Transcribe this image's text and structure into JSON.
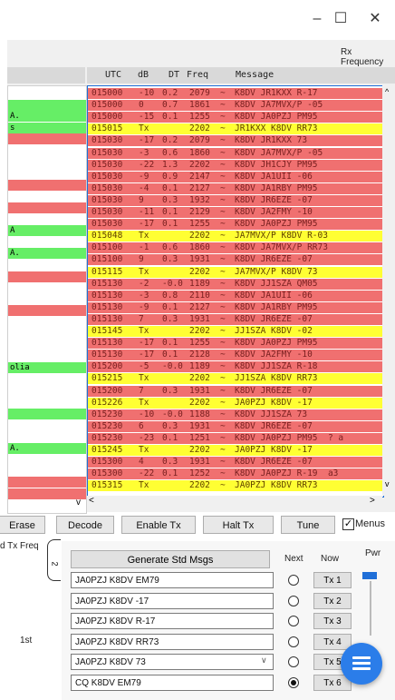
{
  "window": {
    "minimize": "–",
    "maximize": "☐",
    "close": "✕"
  },
  "rx_frequency_label": "Rx Frequency",
  "columns": {
    "utc": "UTC",
    "db": "dB",
    "dt": "DT",
    "freq": "Freq",
    "message": "Message"
  },
  "left_rows": [
    {
      "text": "",
      "color": "#ffffff"
    },
    {
      "text": "",
      "color": "#66ee66"
    },
    {
      "text": "A.",
      "color": "#66ee66"
    },
    {
      "text": "s",
      "color": "#66ee66"
    },
    {
      "text": "",
      "color": "#f07070"
    },
    {
      "text": "",
      "color": "#ffffff"
    },
    {
      "text": "",
      "color": "#ffffff"
    },
    {
      "text": "",
      "color": "#ffffff"
    },
    {
      "text": "",
      "color": "#f07070"
    },
    {
      "text": "",
      "color": "#ffffff"
    },
    {
      "text": "",
      "color": "#f07070"
    },
    {
      "text": "",
      "color": "#ffffff"
    },
    {
      "text": "A",
      "color": "#66ee66"
    },
    {
      "text": "",
      "color": "#ffffff"
    },
    {
      "text": "A.",
      "color": "#66ee66"
    },
    {
      "text": "",
      "color": "#ffffff"
    },
    {
      "text": "",
      "color": "#f07070"
    },
    {
      "text": "",
      "color": "#ffffff"
    },
    {
      "text": "",
      "color": "#ffffff"
    },
    {
      "text": "",
      "color": "#f07070"
    },
    {
      "text": "",
      "color": "#ffffff"
    },
    {
      "text": "",
      "color": "#ffffff"
    },
    {
      "text": "",
      "color": "#ffffff"
    },
    {
      "text": "",
      "color": "#ffffff"
    },
    {
      "text": "olia",
      "color": "#66ee66"
    },
    {
      "text": "",
      "color": "#ffffff"
    },
    {
      "text": "",
      "color": "#ffffff"
    },
    {
      "text": "",
      "color": "#ffffff"
    },
    {
      "text": "",
      "color": "#66ee66"
    },
    {
      "text": "",
      "color": "#ffffff"
    },
    {
      "text": "",
      "color": "#ffffff"
    },
    {
      "text": "A.",
      "color": "#66ee66"
    },
    {
      "text": "",
      "color": "#ffffff"
    },
    {
      "text": "",
      "color": "#ffffff"
    },
    {
      "text": "",
      "color": "#f07070"
    },
    {
      "text": "",
      "color": "#f07070"
    },
    {
      "text": "",
      "color": "#ffffff"
    }
  ],
  "rx_rows": [
    {
      "utc": "015000",
      "db": "-10",
      "dt": "0.2",
      "freq": "2079",
      "sep": "~",
      "msg": "K8DV JR1KXX R-17",
      "kind": "red"
    },
    {
      "utc": "015000",
      "db": "0",
      "dt": "0.7",
      "freq": "1861",
      "sep": "~",
      "msg": "K8DV JA7MVX/P -05",
      "kind": "red"
    },
    {
      "utc": "015000",
      "db": "-15",
      "dt": "0.1",
      "freq": "1255",
      "sep": "~",
      "msg": "K8DV JA0PZJ PM95",
      "kind": "red"
    },
    {
      "utc": "015015",
      "db": "Tx",
      "dt": "",
      "freq": "2202",
      "sep": "~",
      "msg": "JR1KXX K8DV RR73",
      "kind": "yellow"
    },
    {
      "utc": "015030",
      "db": "-17",
      "dt": "0.2",
      "freq": "2079",
      "sep": "~",
      "msg": "K8DV JR1KXX 73",
      "kind": "red"
    },
    {
      "utc": "015030",
      "db": "-3",
      "dt": "0.6",
      "freq": "1860",
      "sep": "~",
      "msg": "K8DV JA7MVX/P -05",
      "kind": "red"
    },
    {
      "utc": "015030",
      "db": "-22",
      "dt": "1.3",
      "freq": "2202",
      "sep": "~",
      "msg": "K8DV JH1CJY PM95",
      "kind": "red"
    },
    {
      "utc": "015030",
      "db": "-9",
      "dt": "0.9",
      "freq": "2147",
      "sep": "~",
      "msg": "K8DV JA1UII -06",
      "kind": "red"
    },
    {
      "utc": "015030",
      "db": "-4",
      "dt": "0.1",
      "freq": "2127",
      "sep": "~",
      "msg": "K8DV JA1RBY PM95",
      "kind": "red"
    },
    {
      "utc": "015030",
      "db": "9",
      "dt": "0.3",
      "freq": "1932",
      "sep": "~",
      "msg": "K8DV JR6EZE -07",
      "kind": "red"
    },
    {
      "utc": "015030",
      "db": "-11",
      "dt": "0.1",
      "freq": "2129",
      "sep": "~",
      "msg": "K8DV JA2FMY -10",
      "kind": "red"
    },
    {
      "utc": "015030",
      "db": "-17",
      "dt": "0.1",
      "freq": "1255",
      "sep": "~",
      "msg": "K8DV JA0PZJ PM95",
      "kind": "red"
    },
    {
      "utc": "015048",
      "db": "Tx",
      "dt": "",
      "freq": "2202",
      "sep": "~",
      "msg": "JA7MVX/P K8DV R-03",
      "kind": "yellow"
    },
    {
      "utc": "015100",
      "db": "-1",
      "dt": "0.6",
      "freq": "1860",
      "sep": "~",
      "msg": "K8DV JA7MVX/P RR73",
      "kind": "red"
    },
    {
      "utc": "015100",
      "db": "9",
      "dt": "0.3",
      "freq": "1931",
      "sep": "~",
      "msg": "K8DV JR6EZE -07",
      "kind": "red"
    },
    {
      "utc": "015115",
      "db": "Tx",
      "dt": "",
      "freq": "2202",
      "sep": "~",
      "msg": "JA7MVX/P K8DV 73",
      "kind": "yellow"
    },
    {
      "utc": "015130",
      "db": "-2",
      "dt": "-0.0",
      "freq": "1189",
      "sep": "~",
      "msg": "K8DV JJ1SZA QM05",
      "kind": "red"
    },
    {
      "utc": "015130",
      "db": "-3",
      "dt": "0.8",
      "freq": "2110",
      "sep": "~",
      "msg": "K8DV JA1UII -06",
      "kind": "red"
    },
    {
      "utc": "015130",
      "db": "-9",
      "dt": "0.1",
      "freq": "2127",
      "sep": "~",
      "msg": "K8DV JA1RBY PM95",
      "kind": "red"
    },
    {
      "utc": "015130",
      "db": "7",
      "dt": "0.3",
      "freq": "1931",
      "sep": "~",
      "msg": "K8DV JR6EZE -07",
      "kind": "red"
    },
    {
      "utc": "015145",
      "db": "Tx",
      "dt": "",
      "freq": "2202",
      "sep": "~",
      "msg": "JJ1SZA K8DV -02",
      "kind": "yellow"
    },
    {
      "utc": "015130",
      "db": "-17",
      "dt": "0.1",
      "freq": "1255",
      "sep": "~",
      "msg": "K8DV JA0PZJ PM95",
      "kind": "red"
    },
    {
      "utc": "015130",
      "db": "-17",
      "dt": "0.1",
      "freq": "2128",
      "sep": "~",
      "msg": "K8DV JA2FMY -10",
      "kind": "red"
    },
    {
      "utc": "015200",
      "db": "-5",
      "dt": "-0.0",
      "freq": "1189",
      "sep": "~",
      "msg": "K8DV JJ1SZA R-18",
      "kind": "red"
    },
    {
      "utc": "015215",
      "db": "Tx",
      "dt": "",
      "freq": "2202",
      "sep": "~",
      "msg": "JJ1SZA K8DV RR73",
      "kind": "yellow"
    },
    {
      "utc": "015200",
      "db": "7",
      "dt": "0.3",
      "freq": "1931",
      "sep": "~",
      "msg": "K8DV JR6EZE -07",
      "kind": "red"
    },
    {
      "utc": "015226",
      "db": "Tx",
      "dt": "",
      "freq": "2202",
      "sep": "~",
      "msg": "JA0PZJ K8DV -17",
      "kind": "yellow"
    },
    {
      "utc": "015230",
      "db": "-10",
      "dt": "-0.0",
      "freq": "1188",
      "sep": "~",
      "msg": "K8DV JJ1SZA 73",
      "kind": "red"
    },
    {
      "utc": "015230",
      "db": "6",
      "dt": "0.3",
      "freq": "1931",
      "sep": "~",
      "msg": "K8DV JR6EZE -07",
      "kind": "red"
    },
    {
      "utc": "015230",
      "db": "-23",
      "dt": "0.1",
      "freq": "1251",
      "sep": "~",
      "msg": "K8DV JA0PZJ PM95  ? a",
      "kind": "red"
    },
    {
      "utc": "015245",
      "db": "Tx",
      "dt": "",
      "freq": "2202",
      "sep": "~",
      "msg": "JA0PZJ K8DV -17",
      "kind": "yellow"
    },
    {
      "utc": "015300",
      "db": "4",
      "dt": "0.3",
      "freq": "1931",
      "sep": "~",
      "msg": "K8DV JR6EZE -07",
      "kind": "red"
    },
    {
      "utc": "015300",
      "db": "-22",
      "dt": "0.1",
      "freq": "1252",
      "sep": "~",
      "msg": "K8DV JA0PZJ R-19  a3",
      "kind": "red"
    },
    {
      "utc": "015315",
      "db": "Tx",
      "dt": "",
      "freq": "2202",
      "sep": "~",
      "msg": "JA0PZJ K8DV RR73",
      "kind": "yellow"
    }
  ],
  "buttons": {
    "erase": "Erase",
    "decode": "Decode",
    "enable_tx": "Enable Tx",
    "halt_tx": "Halt Tx",
    "tune": "Tune",
    "menus": "Menus"
  },
  "side_labels": {
    "tx_freq": "d Tx Freq",
    "first": "1st",
    "pwr": "Pwr"
  },
  "gen_std_msgs": "Generate Std Msgs",
  "col_next": "Next",
  "col_now": "Now",
  "tx_messages": [
    {
      "text": "JA0PZJ K8DV EM79",
      "tx": "Tx 1",
      "selected": false
    },
    {
      "text": "JA0PZJ K8DV -17",
      "tx": "Tx 2",
      "selected": false
    },
    {
      "text": "JA0PZJ K8DV R-17",
      "tx": "Tx 3",
      "selected": false
    },
    {
      "text": "JA0PZJ K8DV RR73",
      "tx": "Tx 4",
      "selected": false
    },
    {
      "text": "JA0PZJ K8DV 73",
      "tx": "Tx 5",
      "selected": false
    },
    {
      "text": "CQ K8DV EM79",
      "tx": "Tx 6",
      "selected": true
    }
  ],
  "colors": {
    "rx_red": "#f07070",
    "tx_yellow": "#ffff33",
    "cq_green": "#66ee66",
    "accent": "#2b7de9"
  }
}
